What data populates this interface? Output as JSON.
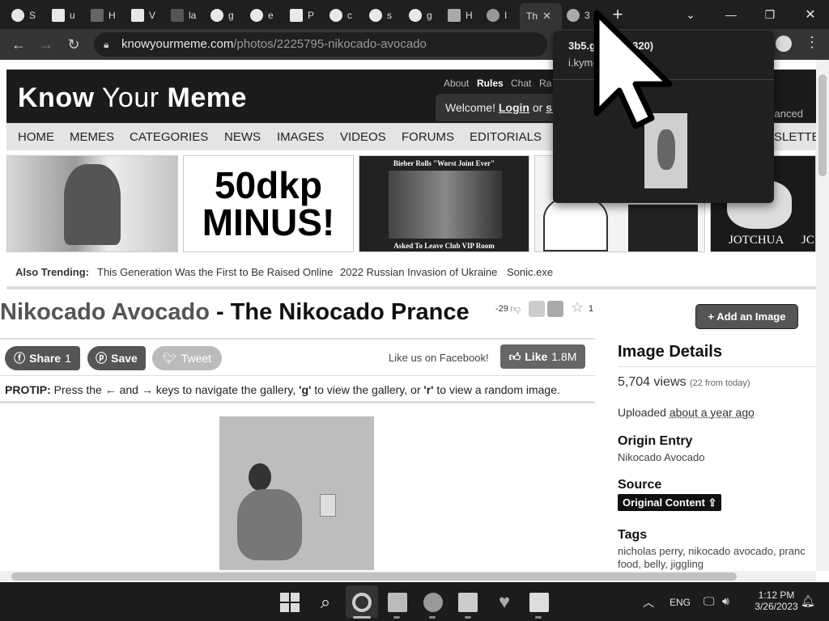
{
  "browser": {
    "tabs": [
      {
        "label": "S"
      },
      {
        "label": "u"
      },
      {
        "label": "H"
      },
      {
        "label": "V"
      },
      {
        "label": "la"
      },
      {
        "label": "g"
      },
      {
        "label": "e"
      },
      {
        "label": "P"
      },
      {
        "label": "c"
      },
      {
        "label": "s"
      },
      {
        "label": "g"
      },
      {
        "label": "H"
      },
      {
        "label": "I"
      },
      {
        "label": "Th"
      },
      {
        "label": "3"
      }
    ],
    "url_host": "knowyourmeme.com",
    "url_path": "/photos/2225795-nikocado-avocado"
  },
  "hover_popup": {
    "title": "3b5.gif (180×320)",
    "host": "i.kym-cdn.com"
  },
  "site": {
    "logo_bold1": "Know",
    "logo_light": " Your ",
    "logo_bold2": "Meme",
    "top_links": [
      "About",
      "Rules",
      "Chat",
      "Ra"
    ],
    "welcome": "Welcome!",
    "login": "Login",
    "or": "or",
    "signup": "si",
    "adv_search": "vanced Se",
    "nav": [
      "HOME",
      "MEMES",
      "CATEGORIES",
      "NEWS",
      "IMAGES",
      "VIDEOS",
      "FORUMS",
      "EDITORIALS"
    ],
    "nav_extra": "SLETTE"
  },
  "thumbs": {
    "t2_text": "50dkp MINUS!",
    "t3_top": "Bieber Rolls \"Worst Joint Ever\"",
    "t3_bottom": "Asked To Leave Club VIP Room",
    "t6_text": "JOTCHUA",
    "t7_text": "JC"
  },
  "trending": {
    "label": "Also Trending:",
    "items": [
      "This Generation Was the First to Be Raised Online",
      "2022 Russian Invasion of Ukraine",
      "Sonic.exe"
    ]
  },
  "entry": {
    "title_link": "Nikocado Avocado",
    "title_rest": " - The Nikocado Prance",
    "score": "-29",
    "fav_count": "1",
    "add_image": "+ Add an Image",
    "share": "Share",
    "share_count": "1",
    "save": "Save",
    "tweet": "Tweet",
    "like_fb": "Like us on Facebook!",
    "like": "Like",
    "like_count": "1.8M",
    "protip_label": "PROTIP:",
    "protip_a": " Press the ← and → keys to navigate the gallery, ",
    "protip_g": "'g'",
    "protip_b": " to view the gallery, or ",
    "protip_r": "'r'",
    "protip_c": " to view a random image."
  },
  "sidebar": {
    "heading": "Image Details",
    "views": "5,704 views",
    "views_today": "(22 from today)",
    "uploaded_label": "Uploaded",
    "uploaded_value": "about a year ago",
    "origin_label": "Origin Entry",
    "origin_value": "Nikocado Avocado",
    "source_label": "Source",
    "source_badge": "Original Content",
    "tags_label": "Tags",
    "tags_line1": "nicholas perry, nikocado avocado, pranc",
    "tags_line2": "food, belly, jiggling"
  },
  "taskbar": {
    "lang": "ENG",
    "time": "1:12 PM",
    "date": "3/26/2023"
  }
}
